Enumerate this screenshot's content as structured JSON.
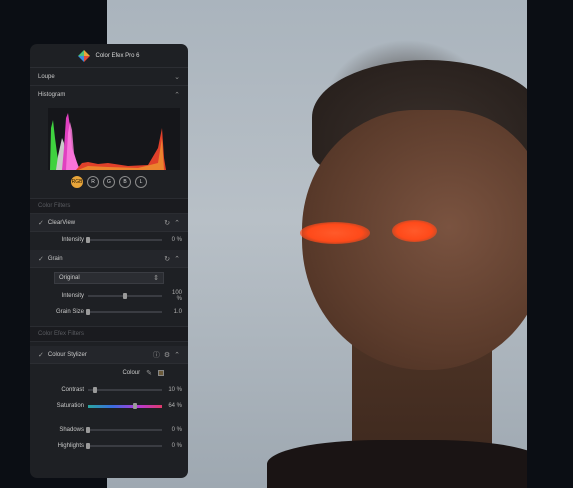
{
  "panel": {
    "app_title": "Color Efex Pro 6",
    "loupe_label": "Loupe",
    "histogram_label": "Histogram",
    "channels": [
      "RGB",
      "R",
      "G",
      "B",
      "L"
    ],
    "active_channel": "RGB",
    "section_color_filters": "Color Filters",
    "clearview": {
      "name": "ClearView",
      "intensity_label": "Intensity",
      "intensity_value": "0 %",
      "intensity_level": 0
    },
    "grain": {
      "name": "Grain",
      "preset": "Original",
      "intensity_label": "Intensity",
      "intensity_value": "100 %",
      "intensity_level": 0.5,
      "grain_size_label": "Grain Size",
      "grain_size_value": "1.0",
      "grain_size_level": 0.0
    },
    "section_color_efex_filters": "Color Efex Filters",
    "colour_stylizer": {
      "name": "Colour Stylizer",
      "colour_label": "Colour",
      "contrast_label": "Contrast",
      "contrast_value": "10 %",
      "contrast_level": 0.1,
      "saturation_label": "Saturation",
      "saturation_value": "64 %",
      "saturation_level": 0.64,
      "shadows_label": "Shadows",
      "shadows_value": "0 %",
      "shadows_level": 0,
      "highlights_label": "Highlights",
      "highlights_value": "0 %",
      "highlights_level": 0
    }
  },
  "colors": {
    "accent": "#e8a53a",
    "panel_bg": "#1e2024",
    "eye_glow": "#ff4a1a"
  }
}
